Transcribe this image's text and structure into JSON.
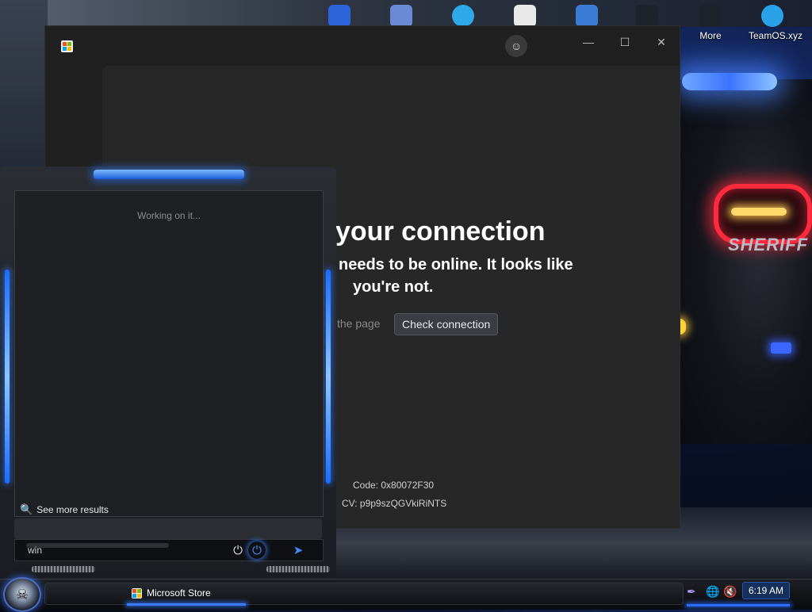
{
  "desktop": {
    "icons": [
      {
        "label": "",
        "color": "#2b63d9"
      },
      {
        "label": "",
        "color": "#6b8ad6"
      },
      {
        "label": "",
        "color": "#2ea8e6"
      },
      {
        "label": "",
        "color": "#e9e9e9"
      },
      {
        "label": "",
        "color": "#3a7bd5"
      },
      {
        "label": "",
        "color": "#1d222c"
      },
      {
        "label": "More",
        "color": "#1d222c"
      },
      {
        "label": "TeamOS.xyz",
        "color": "#2aa2e8"
      }
    ],
    "wallpaper_text": "SHERIFF"
  },
  "store_window": {
    "title_icon": "store-icon",
    "error": {
      "title": "your connection",
      "line1": "needs to be online. It looks like",
      "line2": "you're not.",
      "refresh_link": "the page",
      "check_button": "Check connection",
      "code": "Code: 0x80072F30",
      "cv": "CV: p9p9szQGVkiRiNTS"
    },
    "controls": {
      "minimize": "—",
      "maximize": "☐",
      "close": "✕"
    }
  },
  "start_menu": {
    "status": "Working on it...",
    "see_more": "See more results",
    "search_value": "win"
  },
  "taskbar": {
    "active_app": "Microsoft Store",
    "clock": "6:19 AM"
  },
  "colors": {
    "accent_blue": "#2d6cff",
    "check_button_bg": "#3b3d44"
  }
}
